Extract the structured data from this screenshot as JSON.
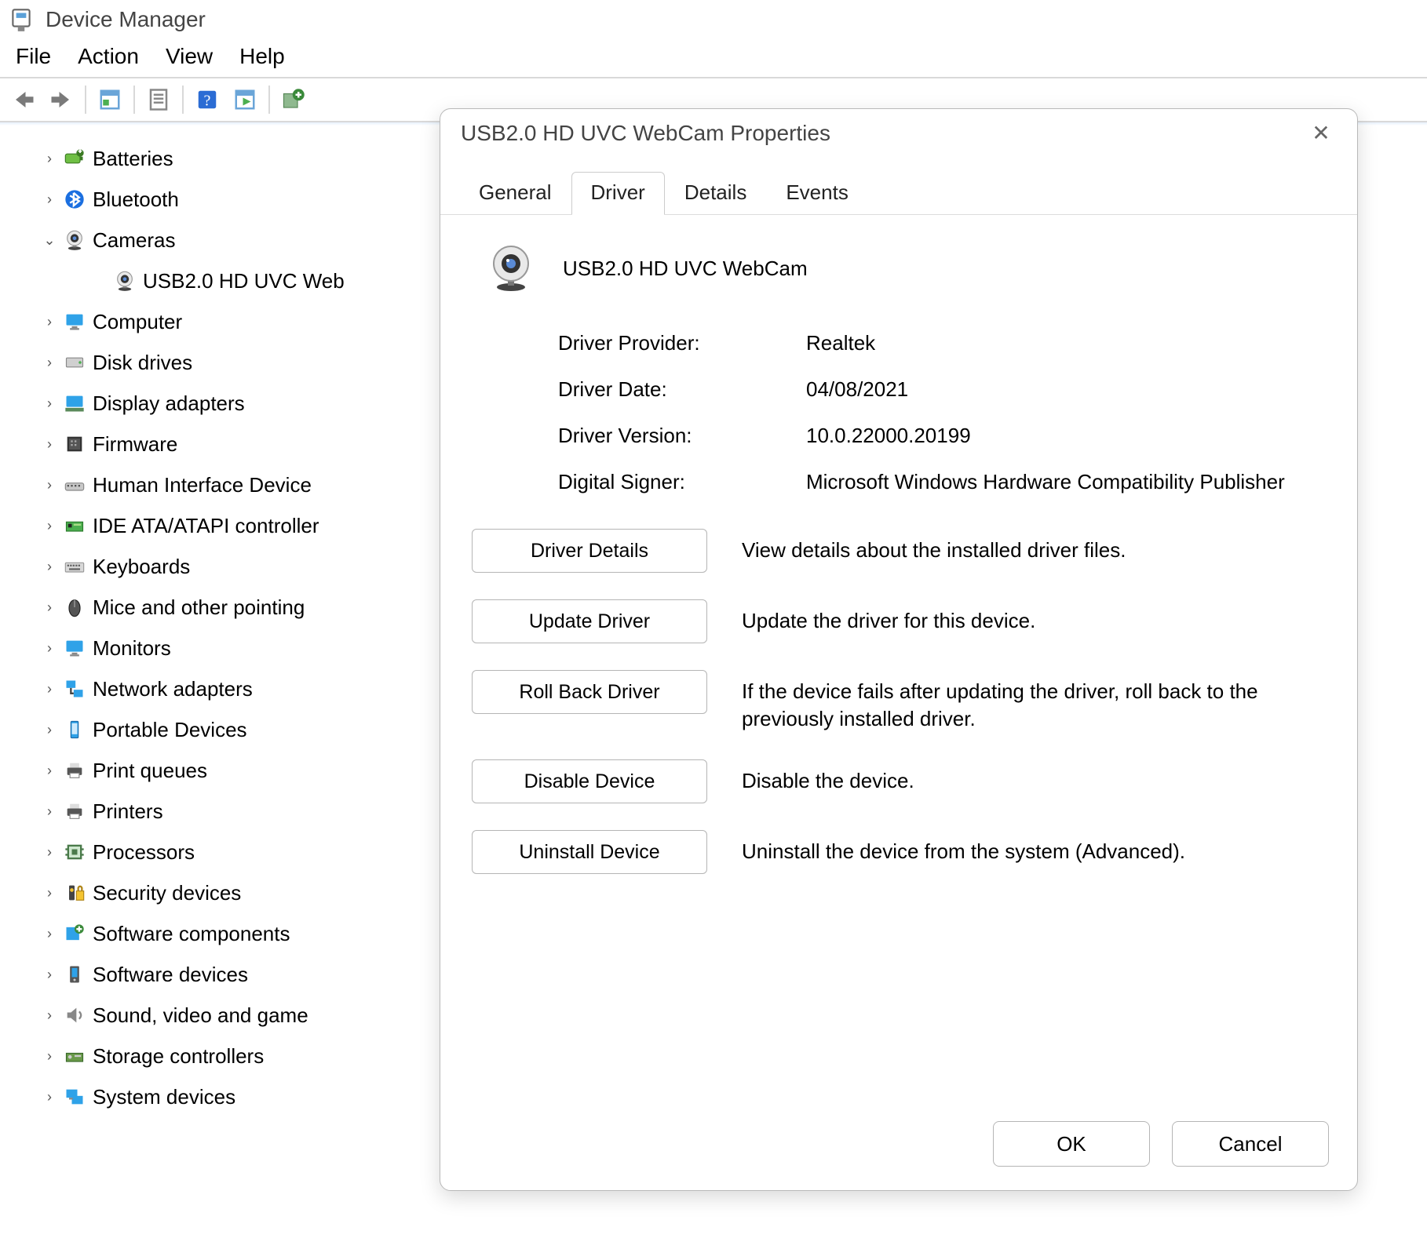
{
  "window": {
    "title": "Device Manager"
  },
  "menu": {
    "file": "File",
    "action": "Action",
    "view": "View",
    "help": "Help"
  },
  "toolbar_icons": {
    "back": "back-arrow-icon",
    "forward": "forward-arrow-icon",
    "up": "app-window-icon",
    "properties": "properties-sheet-icon",
    "help": "help-icon",
    "scan": "scan-hardware-icon",
    "add": "add-hardware-icon"
  },
  "tree": {
    "items": [
      {
        "label": "Batteries",
        "icon": "battery-icon",
        "expanded": false
      },
      {
        "label": "Bluetooth",
        "icon": "bluetooth-icon",
        "expanded": false
      },
      {
        "label": "Cameras",
        "icon": "camera-icon",
        "expanded": true,
        "children": [
          {
            "label": "USB2.0 HD UVC Web",
            "icon": "camera-icon"
          }
        ]
      },
      {
        "label": "Computer",
        "icon": "monitor-icon",
        "expanded": false
      },
      {
        "label": "Disk drives",
        "icon": "disk-icon",
        "expanded": false
      },
      {
        "label": "Display adapters",
        "icon": "display-adapter-icon",
        "expanded": false
      },
      {
        "label": "Firmware",
        "icon": "firmware-icon",
        "expanded": false
      },
      {
        "label": "Human Interface Device",
        "icon": "hid-icon",
        "expanded": false
      },
      {
        "label": "IDE ATA/ATAPI controller",
        "icon": "ide-icon",
        "expanded": false
      },
      {
        "label": "Keyboards",
        "icon": "keyboard-icon",
        "expanded": false
      },
      {
        "label": "Mice and other pointing",
        "icon": "mouse-icon",
        "expanded": false
      },
      {
        "label": "Monitors",
        "icon": "monitor-icon",
        "expanded": false
      },
      {
        "label": "Network adapters",
        "icon": "network-icon",
        "expanded": false
      },
      {
        "label": "Portable Devices",
        "icon": "portable-icon",
        "expanded": false
      },
      {
        "label": "Print queues",
        "icon": "printer-icon",
        "expanded": false
      },
      {
        "label": "Printers",
        "icon": "printer-icon",
        "expanded": false
      },
      {
        "label": "Processors",
        "icon": "cpu-icon",
        "expanded": false
      },
      {
        "label": "Security devices",
        "icon": "security-icon",
        "expanded": false
      },
      {
        "label": "Software components",
        "icon": "software-comp-icon",
        "expanded": false
      },
      {
        "label": "Software devices",
        "icon": "software-dev-icon",
        "expanded": false
      },
      {
        "label": "Sound, video and game",
        "icon": "sound-icon",
        "expanded": false
      },
      {
        "label": "Storage controllers",
        "icon": "storage-icon",
        "expanded": false
      },
      {
        "label": "System devices",
        "icon": "system-icon",
        "expanded": false
      }
    ]
  },
  "dialog": {
    "title": "USB2.0 HD UVC WebCam Properties",
    "tabs": {
      "general": "General",
      "driver": "Driver",
      "details": "Details",
      "events": "Events"
    },
    "active_tab": "driver",
    "device_name": "USB2.0 HD UVC WebCam",
    "info": {
      "provider_label": "Driver Provider:",
      "provider_value": "Realtek",
      "date_label": "Driver Date:",
      "date_value": "04/08/2021",
      "version_label": "Driver Version:",
      "version_value": "10.0.22000.20199",
      "signer_label": "Digital Signer:",
      "signer_value": "Microsoft Windows Hardware Compatibility Publisher"
    },
    "actions": {
      "details_btn": "Driver Details",
      "details_desc": "View details about the installed driver files.",
      "update_btn": "Update Driver",
      "update_desc": "Update the driver for this device.",
      "rollback_btn": "Roll Back Driver",
      "rollback_desc": "If the device fails after updating the driver, roll back to the previously installed driver.",
      "disable_btn": "Disable Device",
      "disable_desc": "Disable the device.",
      "uninstall_btn": "Uninstall Device",
      "uninstall_desc": "Uninstall the device from the system (Advanced)."
    },
    "footer": {
      "ok": "OK",
      "cancel": "Cancel"
    }
  }
}
